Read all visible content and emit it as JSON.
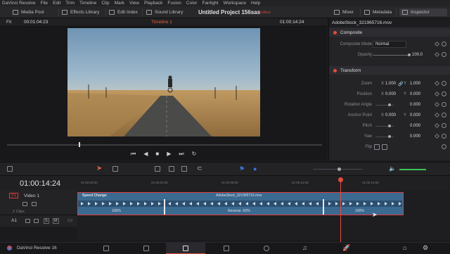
{
  "menu": {
    "items": [
      "DaVinci Resolve",
      "File",
      "Edit",
      "Trim",
      "Timeline",
      "Clip",
      "Mark",
      "View",
      "Playback",
      "Fusion",
      "Color",
      "Fairlight",
      "Workspace",
      "Help"
    ]
  },
  "toolbar": {
    "media_pool": "Media Pool",
    "effects_library": "Effects Library",
    "edit_index": "Edit Index",
    "sound_library": "Sound Library",
    "project_title": "Untitled Project 156sas",
    "edited_label": "Edited",
    "mixer": "Mixer",
    "metadata": "Metadata",
    "inspector": "Inspector"
  },
  "viewer": {
    "fit": "Fit",
    "source_timecode": "00:01:04:23",
    "timeline_name": "Timeline 1",
    "record_timecode": "01:00:14:24"
  },
  "inspector": {
    "clip_name": "AdobeStock_321965716.mov",
    "composite": {
      "title": "Composite",
      "mode_label": "Composite Mode",
      "mode_value": "Normal",
      "opacity_label": "Opacity",
      "opacity_value": "100.0"
    },
    "transform": {
      "title": "Transform",
      "zoom_label": "Zoom",
      "zoom_x": "1.000",
      "zoom_y": "1.000",
      "position_label": "Position",
      "pos_x": "0.000",
      "pos_y": "0.000",
      "rotation_label": "Rotation Angle",
      "rotation": "0.000",
      "anchor_label": "Anchor Point",
      "anchor_x": "0.000",
      "anchor_y": "0.000",
      "pitch_label": "Pitch",
      "pitch": "0.000",
      "yaw_label": "Yaw",
      "yaw": "0.000",
      "flip_label": "Flip"
    },
    "axis_x": "X",
    "axis_y": "Y"
  },
  "timeline": {
    "timecode": "01:00:14:24",
    "ruler_ticks": [
      "01:00:00:00",
      "01:00:04:00",
      "01:00:08:00",
      "01:00:12:00",
      "01:00:16:00"
    ],
    "video_track": {
      "id": "V1",
      "name": "Video 1",
      "clips": "2 Clips"
    },
    "audio_track": {
      "id": "A1",
      "level": "2.0"
    },
    "clip": {
      "speed_change": "Speed Change",
      "name": "AdobeStock_321965716.mov",
      "speed1": "100%",
      "speed2": "Reverse -50%",
      "speed3": "100%"
    }
  },
  "footer": {
    "app": "DaVinci Resolve 16"
  },
  "colors": {
    "accent_red": "#e03a3a",
    "clip_blue": "#3b6a91",
    "timecode_orange": "#e0643c"
  }
}
